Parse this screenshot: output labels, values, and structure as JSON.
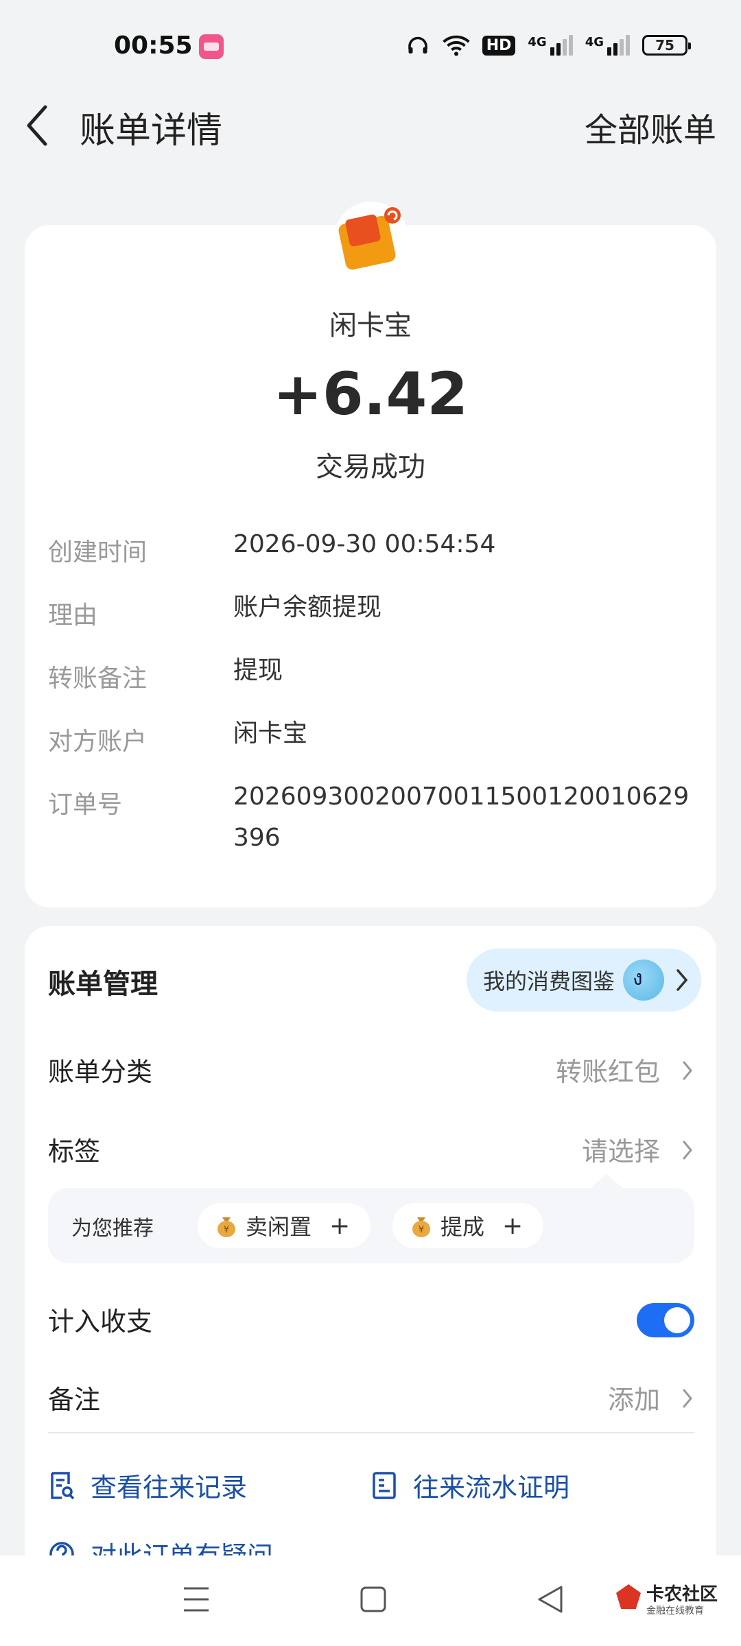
{
  "status_bar": {
    "time": "00:55",
    "hd_label": "HD",
    "net_label_1": "4G",
    "net_label_2": "4G",
    "battery": "75"
  },
  "nav": {
    "title": "账单详情",
    "all_bills": "全部账单"
  },
  "summary": {
    "merchant_name": "闲卡宝",
    "amount": "+6.42",
    "status": "交易成功"
  },
  "details": [
    {
      "key": "创建时间",
      "value": "2026-09-30 00:54:54"
    },
    {
      "key": "理由",
      "value": "账户余额提现"
    },
    {
      "key": "转账备注",
      "value": "提现"
    },
    {
      "key": "对方账户",
      "value": "闲卡宝"
    },
    {
      "key": "订单号",
      "value": "20260930020070011500120010629396"
    }
  ],
  "manage": {
    "title": "账单管理",
    "gallery_label": "我的消费图鉴",
    "category_label": "账单分类",
    "category_value": "转账红包",
    "tag_label": "标签",
    "tag_value": "请选择",
    "recommend_label": "为您推荐",
    "chips": [
      "卖闲置",
      "提成"
    ],
    "chip_plus": "+",
    "income_label": "计入收支",
    "income_enabled": true,
    "note_label": "备注",
    "note_value": "添加",
    "link_records": "查看往来记录",
    "link_proof": "往来流水证明",
    "link_question": "对此订单有疑问"
  },
  "watermark": {
    "title": "卡农社区",
    "subtitle": "金融在线教育"
  },
  "colors": {
    "accent": "#1e6ef5",
    "link": "#1a4fa8",
    "logo_orange": "#f29a12"
  }
}
